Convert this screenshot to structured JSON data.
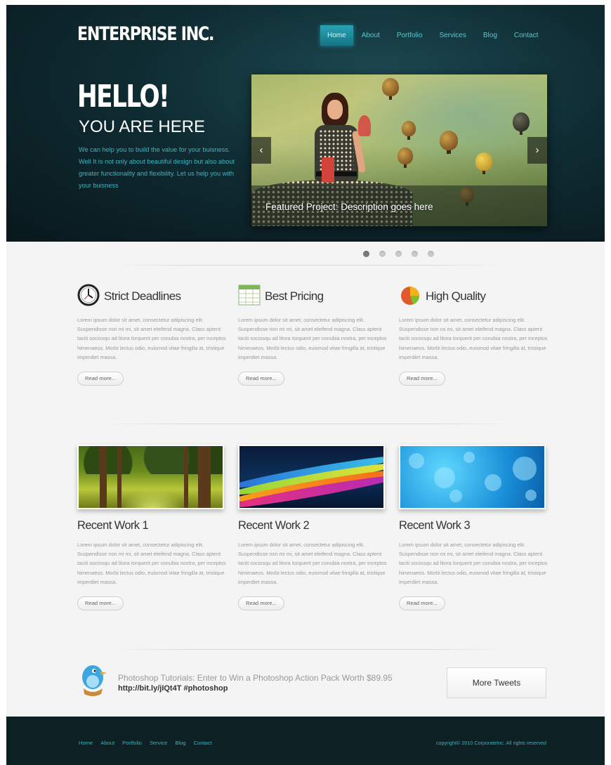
{
  "brand": {
    "logo": "ENTERPRISE INC."
  },
  "nav": {
    "items": [
      {
        "label": "Home",
        "active": true
      },
      {
        "label": "About"
      },
      {
        "label": "Portfolio"
      },
      {
        "label": "Services"
      },
      {
        "label": "Blog"
      },
      {
        "label": "Contact"
      }
    ]
  },
  "hero": {
    "headline": "HELLO!",
    "subheadline": "YOU ARE HERE",
    "intro": "We can help you to build the value for your buisness. Well It is not only about beautiful design but also about greater functionality and flexibility. Let us help you with your buisness",
    "slider": {
      "caption": "Featured Project: Description goes here",
      "prev_glyph": "‹",
      "next_glyph": "›",
      "dots": 5,
      "active_dot": 1
    }
  },
  "features": [
    {
      "title": "Strict Deadlines",
      "icon": "clock-icon",
      "text": "Lorem ipsum dolor sit amet, consectetur adipiscing elit. Suspendisse non mi mi, sit amet eleifend magna. Class aptent taciti sociosqu ad litora torquent per conubia nostra, per inceptos himenaeos. Morbi lectus odio, euismod vitae fringilla at, tristique imperdiet massa.",
      "button": "Read more..."
    },
    {
      "title": "Best Pricing",
      "icon": "spreadsheet-icon",
      "text": "Lorem ipsum dolor sit amet, consectetur adipiscing elit. Suspendisse non mi mi, sit amet eleifend magna. Class aptent taciti sociosqu ad litora torquent per conubia nostra, per inceptos himenaeos. Morbi lectus odio, euismod vitae fringilla at, tristique imperdiet massa.",
      "button": "Read more..."
    },
    {
      "title": "High Quality",
      "icon": "pie-chart-icon",
      "text": "Lorem ipsum dolor sit amet, consectetur adipiscing elit. Suspendisse non mi mi, sit amet eleifend magna. Class aptent taciti sociosqu ad litora torquent per conubia nostra, per inceptos himenaeos. Morbi lectus odio, euismod vitae fringilla at, tristique imperdiet massa.",
      "button": "Read more..."
    }
  ],
  "works": [
    {
      "title": "Recent Work 1",
      "text": "Lorem ipsum dolor sit amet, consectetur adipiscing elit. Suspendisse non mi mi, sit amet eleifend magna. Class aptent taciti sociosqu ad litora torquent per conubia nostra, per inceptos himenaeos. Morbi lectus odio, euismod vitae fringilla at, tristique imperdiet massa.",
      "button": "Read more..."
    },
    {
      "title": "Recent Work 2",
      "text": "Lorem ipsum dolor sit amet, consectetur adipiscing elit. Suspendisse non mi mi, sit amet eleifend magna. Class aptent taciti sociosqu ad litora torquent per conubia nostra, per inceptos himenaeos. Morbi lectus odio, euismod vitae fringilla at, tristique imperdiet massa.",
      "button": "Read more..."
    },
    {
      "title": "Recent Work 3",
      "text": "Lorem ipsum dolor sit amet, consectetur adipiscing elit. Suspendisse non mi mi, sit amet eleifend magna. Class aptent taciti sociosqu ad litora torquent per conubia nostra, per inceptos himenaeos. Morbi lectus odio, euismod vitae fringilla at, tristique imperdiet massa.",
      "button": "Read more..."
    }
  ],
  "tweet": {
    "text": "Photoshop Tutorials: Enter to Win a Photoshop Action Pack Worth $89.95",
    "link": "http://bit.ly/jIQt4T #photoshop",
    "button": "More Tweets",
    "icon": "twitter-bird-icon"
  },
  "footer": {
    "links": [
      "Home",
      "About",
      "Portfolio",
      "Service",
      "Blog",
      "Contact"
    ],
    "copyright": "copyright© 2010 CorporateInc. All rights reserved"
  },
  "colors": {
    "header_bg": "#0f2c33",
    "accent": "#3db1c1",
    "nav_active": "#1f8e9e",
    "footer_bg": "#0d2024",
    "page_bg": "#f4f4f4"
  }
}
